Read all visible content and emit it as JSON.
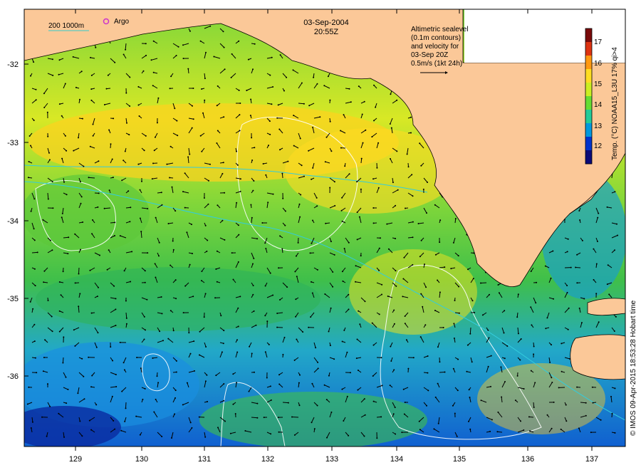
{
  "header": {
    "date": "03-Sep-2004",
    "time": "20:55Z"
  },
  "legend": {
    "contours_label": "200  1000m",
    "argo_label": "Argo",
    "altimetric_note": [
      "Altimetric sealevel",
      "(0.1m contours)",
      "and velocity for",
      "03-Sep 20Z",
      "0.5m/s (1kt 24h)"
    ]
  },
  "colorbar": {
    "title": "Temp. (°C) NOAA15_L3U 17% qi>4",
    "ticks": [
      "12",
      "13",
      "14",
      "15",
      "16",
      "17"
    ],
    "colors": [
      "#0a0a78",
      "#0033cc",
      "#0099dd",
      "#22cc99",
      "#66dd33",
      "#ccee22",
      "#ffdd22",
      "#ff9911",
      "#dd3311",
      "#7a0a0a"
    ]
  },
  "map": {
    "land_color": "#fbc898",
    "x_ticks": [
      "129",
      "130",
      "131",
      "132",
      "133",
      "134",
      "135",
      "136",
      "137"
    ],
    "y_ticks": [
      "-32",
      "-33",
      "-34",
      "-35",
      "-36"
    ]
  },
  "credit": "© IMOS 09-Apr-2015 18:53:28 Hobart time"
}
